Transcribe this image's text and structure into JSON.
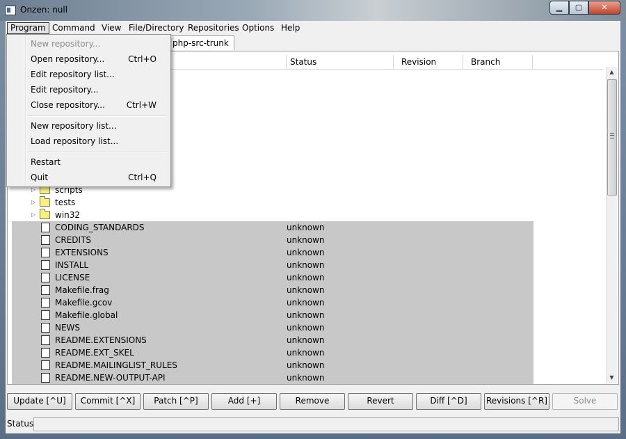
{
  "window": {
    "title": "Onzen: null",
    "minimize_symbol": "▁",
    "maximize_symbol": "▢",
    "close_symbol": "✕"
  },
  "menubar": [
    "Program",
    "Command",
    "View",
    "File/Directory",
    "Repositories",
    "Options",
    "Help"
  ],
  "tab": {
    "label": "php-src-trunk"
  },
  "columns": [
    "Status",
    "Revision",
    "Branch"
  ],
  "folders": [
    {
      "name": "scripts"
    },
    {
      "name": "tests"
    },
    {
      "name": "win32"
    }
  ],
  "files": [
    {
      "name": "CODING_STANDARDS",
      "status": "unknown"
    },
    {
      "name": "CREDITS",
      "status": "unknown"
    },
    {
      "name": "EXTENSIONS",
      "status": "unknown"
    },
    {
      "name": "INSTALL",
      "status": "unknown"
    },
    {
      "name": "LICENSE",
      "status": "unknown"
    },
    {
      "name": "Makefile.frag",
      "status": "unknown"
    },
    {
      "name": "Makefile.gcov",
      "status": "unknown"
    },
    {
      "name": "Makefile.global",
      "status": "unknown"
    },
    {
      "name": "NEWS",
      "status": "unknown"
    },
    {
      "name": "README.EXTENSIONS",
      "status": "unknown"
    },
    {
      "name": "README.EXT_SKEL",
      "status": "unknown"
    },
    {
      "name": "README.MAILINGLIST_RULES",
      "status": "unknown"
    },
    {
      "name": "README.NEW-OUTPUT-API",
      "status": "unknown"
    }
  ],
  "program_menu": {
    "items": [
      {
        "label": "New repository...",
        "shortcut": "",
        "disabled": true
      },
      {
        "label": "Open repository...",
        "shortcut": "Ctrl+O"
      },
      {
        "label": "Edit repository list...",
        "shortcut": ""
      },
      {
        "label": "Edit repository...",
        "shortcut": ""
      },
      {
        "label": "Close repository...",
        "shortcut": "Ctrl+W"
      },
      {
        "label": "New repository list...",
        "shortcut": ""
      },
      {
        "label": "Load repository list...",
        "shortcut": ""
      },
      {
        "label": "Restart",
        "shortcut": ""
      },
      {
        "label": "Quit",
        "shortcut": "Ctrl+Q"
      }
    ]
  },
  "buttons": [
    "Update [^U]",
    "Commit [^X]",
    "Patch [^P]",
    "Add [+]",
    "Remove",
    "Revert",
    "Diff [^D]",
    "Revisions [^R]",
    "Solve"
  ],
  "statusbar": {
    "label": "Status:",
    "value": ""
  }
}
